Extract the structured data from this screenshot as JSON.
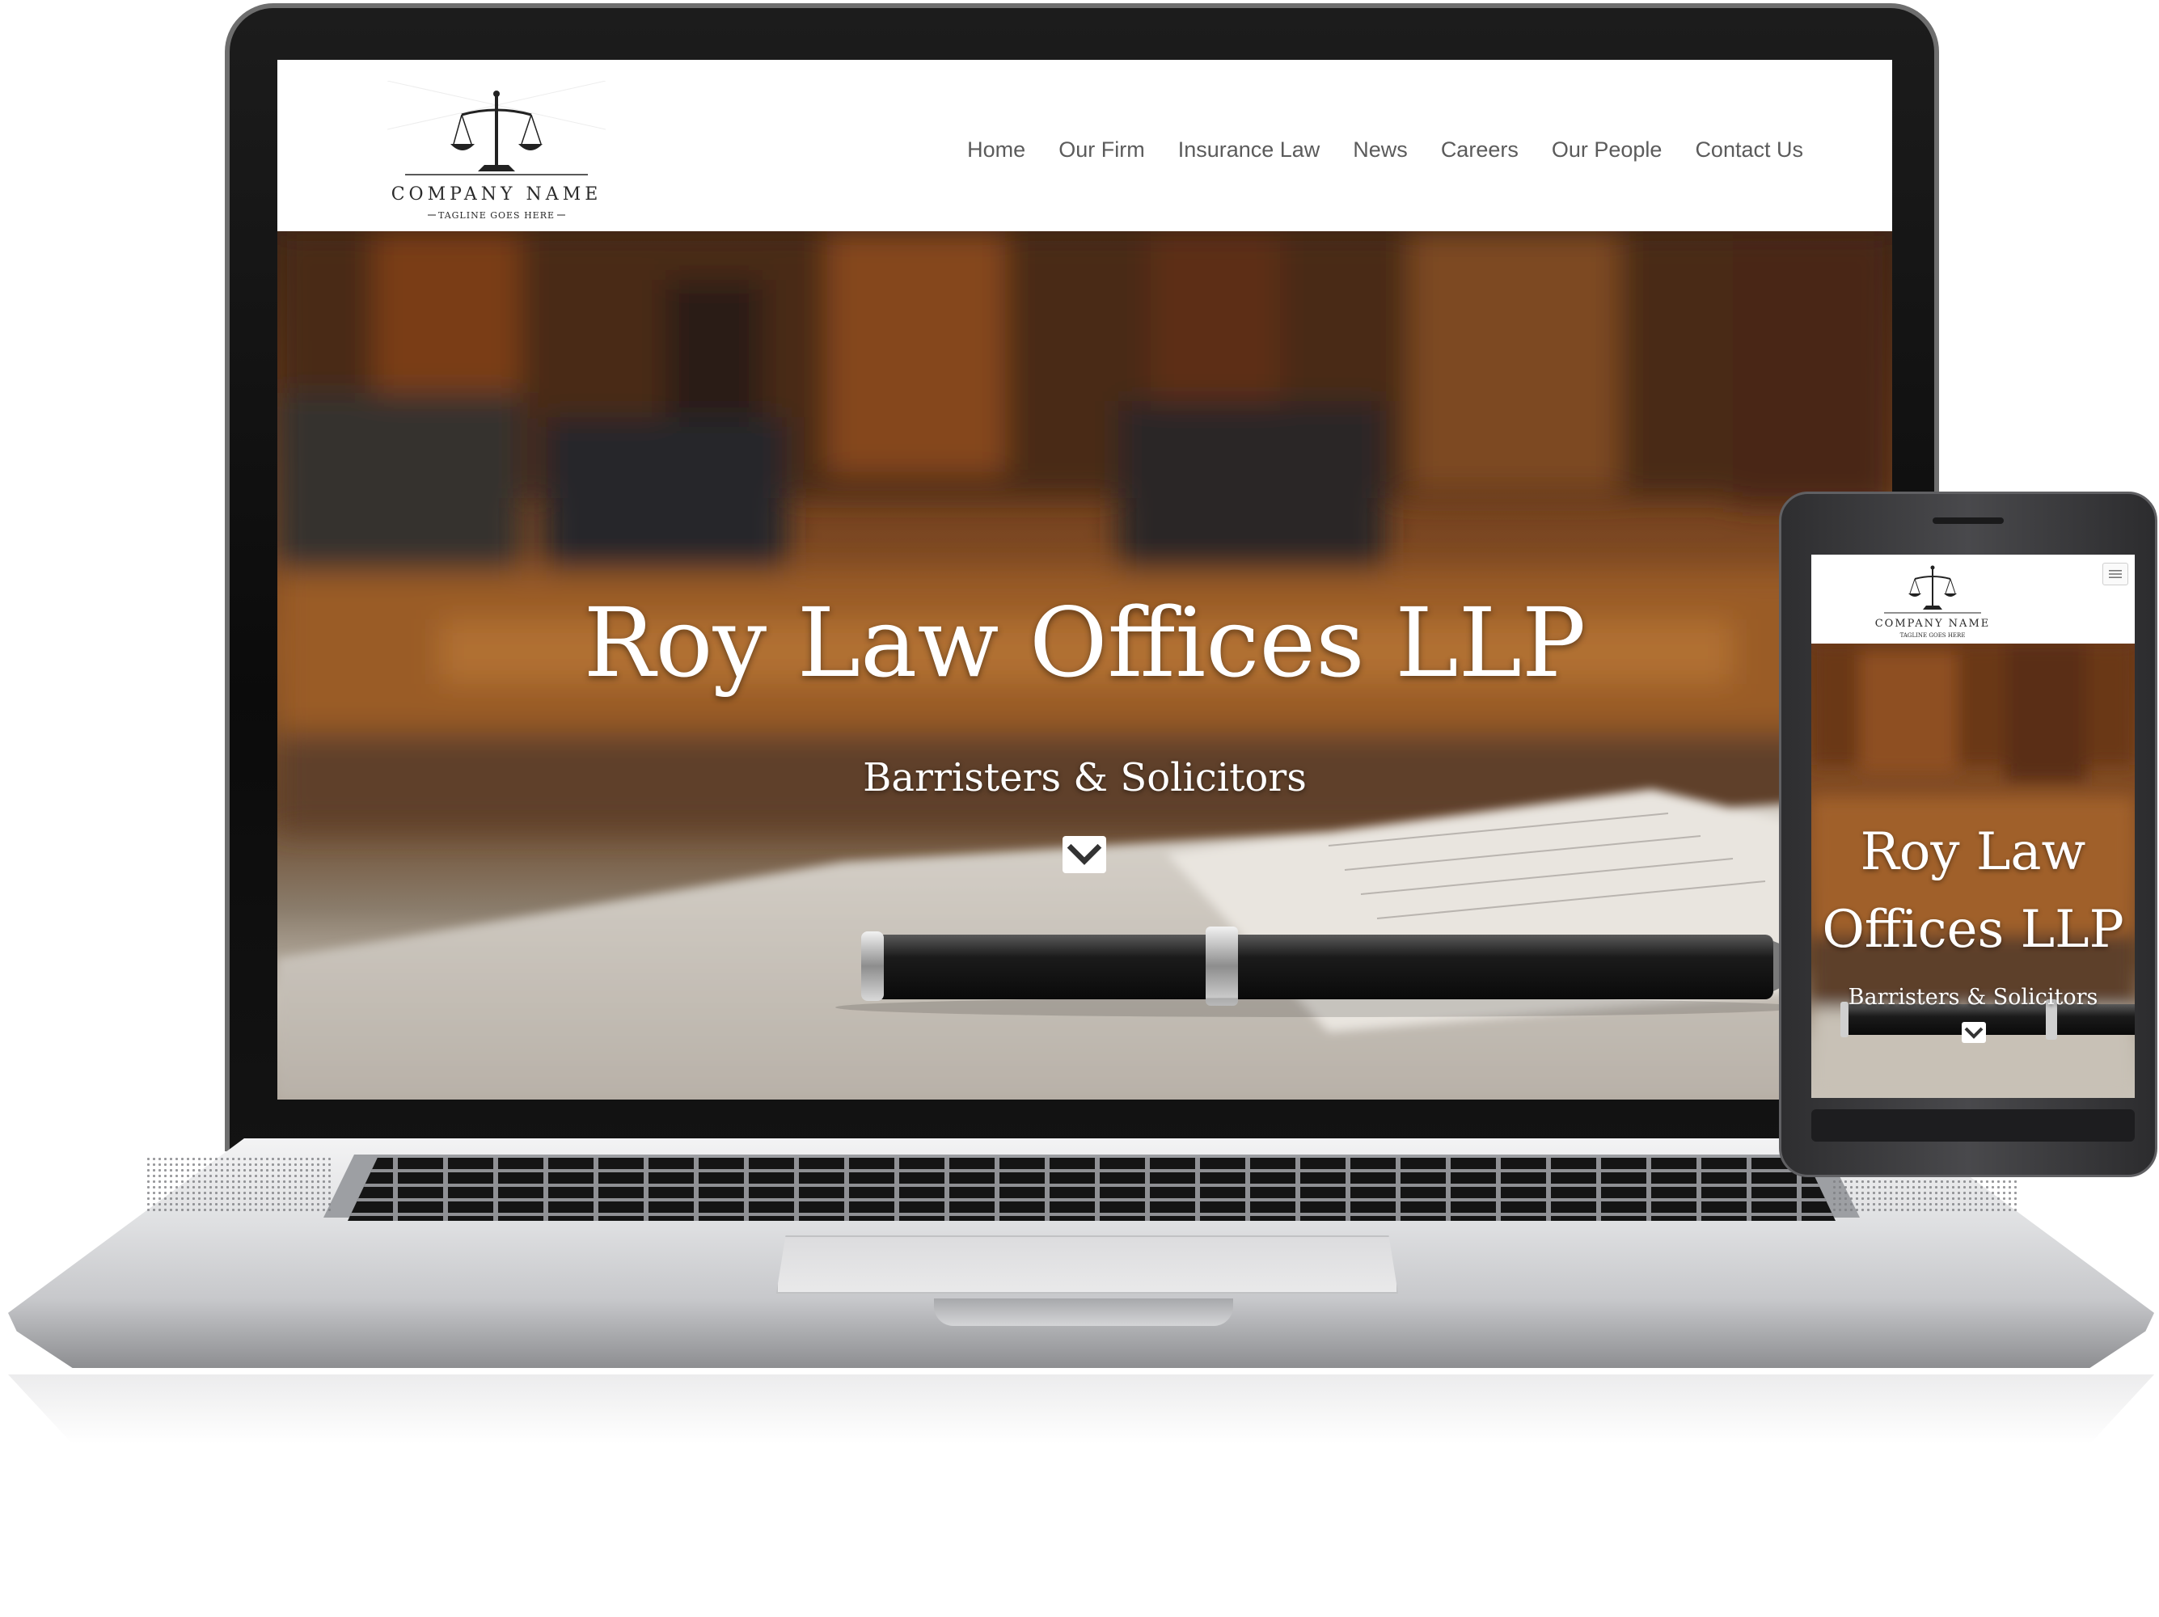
{
  "site": {
    "company_name": "COMPANY NAME",
    "tagline": "TAGLINE GOES HERE",
    "nav": [
      "Home",
      "Our Firm",
      "Insurance Law",
      "News",
      "Careers",
      "Our People",
      "Contact Us"
    ],
    "hero_title": "Roy Law Offices LLP",
    "hero_subtitle": "Barristers & Solicitors"
  },
  "mobile": {
    "company_name": "COMPANY NAME",
    "tagline": "TAGLINE GOES HERE",
    "hero_title_line1": "Roy Law",
    "hero_title_line2": "Offices LLP",
    "hero_subtitle": "Barristers & Solicitors"
  },
  "icons": {
    "logo": "scales-of-justice-icon",
    "scroll": "chevron-down-icon",
    "mobile_menu": "hamburger-menu-icon"
  },
  "colors": {
    "nav_text": "#5b5b5b",
    "hero_text": "#ffffff",
    "hero_wood": "#8c5427"
  }
}
